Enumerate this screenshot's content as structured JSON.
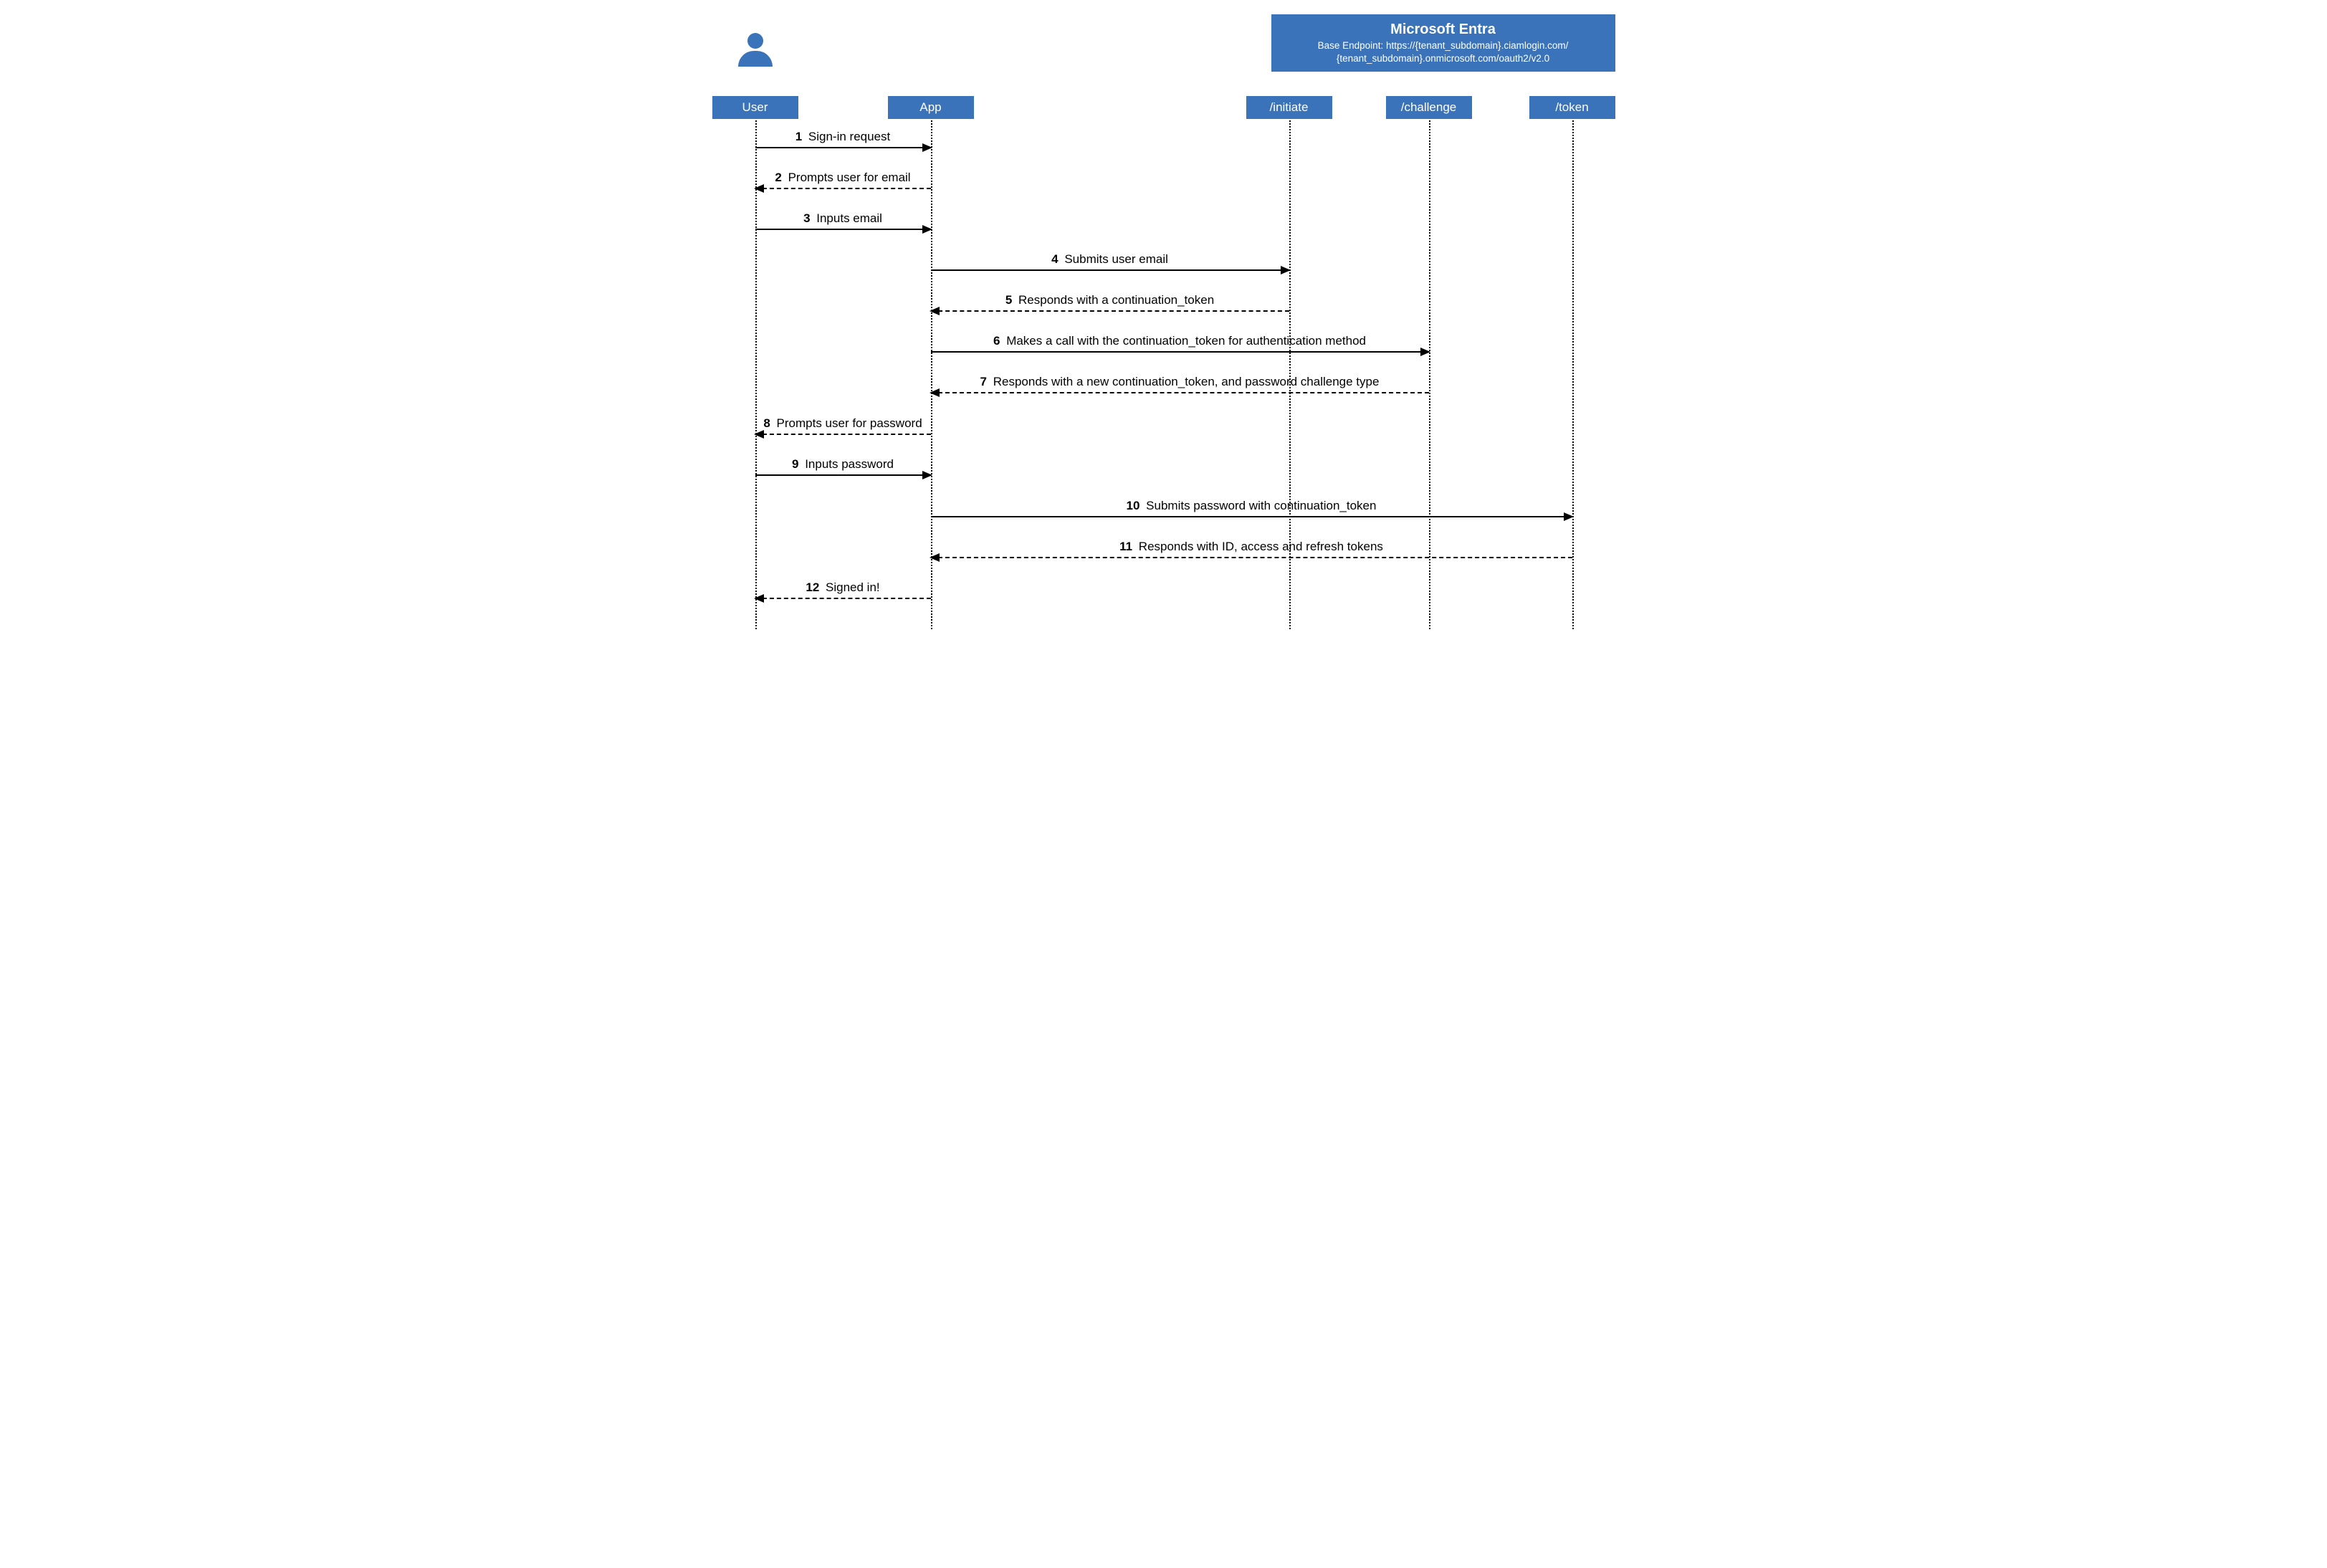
{
  "group": {
    "title": "Microsoft Entra",
    "subtitle1": "Base Endpoint: https://{tenant_subdomain}.ciamlogin.com/",
    "subtitle2": "{tenant_subdomain}.onmicrosoft.com/oauth2/v2.0"
  },
  "actors": {
    "user": "User",
    "app": "App",
    "initiate": "/initiate",
    "challenge": "/challenge",
    "token": "/token"
  },
  "messages": [
    {
      "n": "1",
      "text": "Sign-in request",
      "from": "user",
      "to": "app",
      "style": "solid"
    },
    {
      "n": "2",
      "text": "Prompts user for email",
      "from": "app",
      "to": "user",
      "style": "dashed"
    },
    {
      "n": "3",
      "text": "Inputs email",
      "from": "user",
      "to": "app",
      "style": "solid"
    },
    {
      "n": "4",
      "text": "Submits user email",
      "from": "app",
      "to": "initiate",
      "style": "solid"
    },
    {
      "n": "5",
      "text": "Responds with a continuation_token",
      "from": "initiate",
      "to": "app",
      "style": "dashed"
    },
    {
      "n": "6",
      "text": "Makes a call with the continuation_token for authentication method",
      "from": "app",
      "to": "challenge",
      "style": "solid"
    },
    {
      "n": "7",
      "text": "Responds with a new continuation_token, and password challenge type",
      "from": "challenge",
      "to": "app",
      "style": "dashed"
    },
    {
      "n": "8",
      "text": "Prompts user for password",
      "from": "app",
      "to": "user",
      "style": "dashed"
    },
    {
      "n": "9",
      "text": "Inputs password",
      "from": "user",
      "to": "app",
      "style": "solid"
    },
    {
      "n": "10",
      "text": "Submits password with continuation_token",
      "from": "app",
      "to": "token",
      "style": "solid"
    },
    {
      "n": "11",
      "text": "Responds with  ID, access and refresh tokens",
      "from": "token",
      "to": "app",
      "style": "dashed"
    },
    {
      "n": "12",
      "text": "Signed in!",
      "from": "app",
      "to": "user",
      "style": "dashed"
    }
  ],
  "layout": {
    "x": {
      "user": 80,
      "app": 325,
      "initiate": 825,
      "challenge": 1020,
      "token": 1220
    },
    "msgStartY": 205,
    "msgSpacing": 57,
    "gaps_after": {
      "7": 1,
      "9": 1
    }
  }
}
